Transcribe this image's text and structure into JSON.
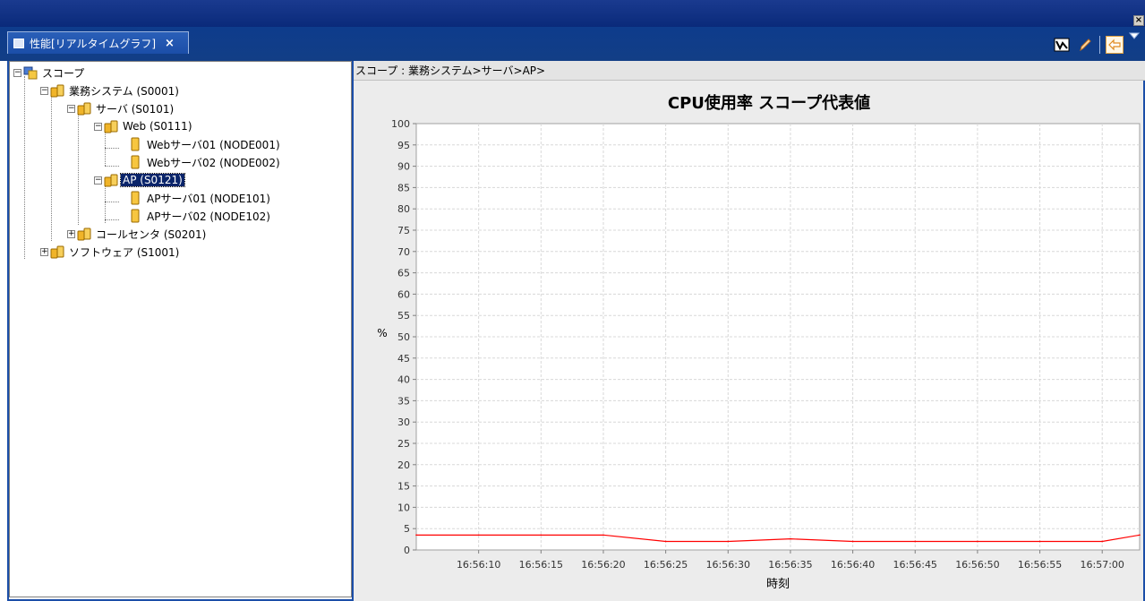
{
  "window": {
    "close_glyph": "×"
  },
  "view": {
    "tab_title": "性能[リアルタイムグラフ]",
    "tab_close": "×"
  },
  "toolbar": {
    "icons": [
      "chart-line-icon",
      "pencil-icon",
      "back-arrow-icon",
      "view-menu-icon"
    ]
  },
  "tree": {
    "nodes": [
      {
        "label": "スコープ",
        "icon": "scope-root-icon"
      },
      {
        "label": "業務システム (S0001)",
        "icon": "scope-folder-icon"
      },
      {
        "label": "サーバ (S0101)",
        "icon": "scope-folder-icon"
      },
      {
        "label": "Web (S0111)",
        "icon": "scope-folder-icon"
      },
      {
        "label": "Webサーバ01 (NODE001)",
        "icon": "node-icon"
      },
      {
        "label": "Webサーバ02 (NODE002)",
        "icon": "node-icon"
      },
      {
        "label": "AP (S0121)",
        "icon": "scope-folder-icon",
        "selected": true
      },
      {
        "label": "APサーバ01 (NODE101)",
        "icon": "node-icon"
      },
      {
        "label": "APサーバ02 (NODE102)",
        "icon": "node-icon"
      },
      {
        "label": "コールセンタ (S0201)",
        "icon": "scope-folder-icon"
      },
      {
        "label": "ソフトウェア (S1001)",
        "icon": "scope-folder-icon"
      }
    ]
  },
  "breadcrumb": "スコープ : 業務システム>サーバ>AP>",
  "colors": {
    "series_line": "#ff0000",
    "selection": "#0a246a",
    "title_bar": "#0e3c8c"
  },
  "chart_data": {
    "type": "line",
    "title": "CPU使用率 スコープ代表値",
    "xlabel": "時刻",
    "ylabel": "%",
    "ylim": [
      0,
      100
    ],
    "yticks": [
      0,
      5,
      10,
      15,
      20,
      25,
      30,
      35,
      40,
      45,
      50,
      55,
      60,
      65,
      70,
      75,
      80,
      85,
      90,
      95,
      100
    ],
    "xtick_labels": [
      "16:56:10",
      "16:56:15",
      "16:56:20",
      "16:56:25",
      "16:56:30",
      "16:56:35",
      "16:56:40",
      "16:56:45",
      "16:56:50",
      "16:56:55",
      "16:57:00"
    ],
    "grid": true,
    "x": [
      "16:56:05",
      "16:56:10",
      "16:56:15",
      "16:56:20",
      "16:56:25",
      "16:56:30",
      "16:56:35",
      "16:56:40",
      "16:56:45",
      "16:56:50",
      "16:56:55",
      "16:57:00",
      "16:57:03"
    ],
    "values": [
      3.5,
      3.5,
      3.5,
      3.5,
      2.0,
      2.0,
      2.6,
      2.0,
      2.0,
      2.0,
      2.0,
      2.0,
      3.5
    ]
  }
}
